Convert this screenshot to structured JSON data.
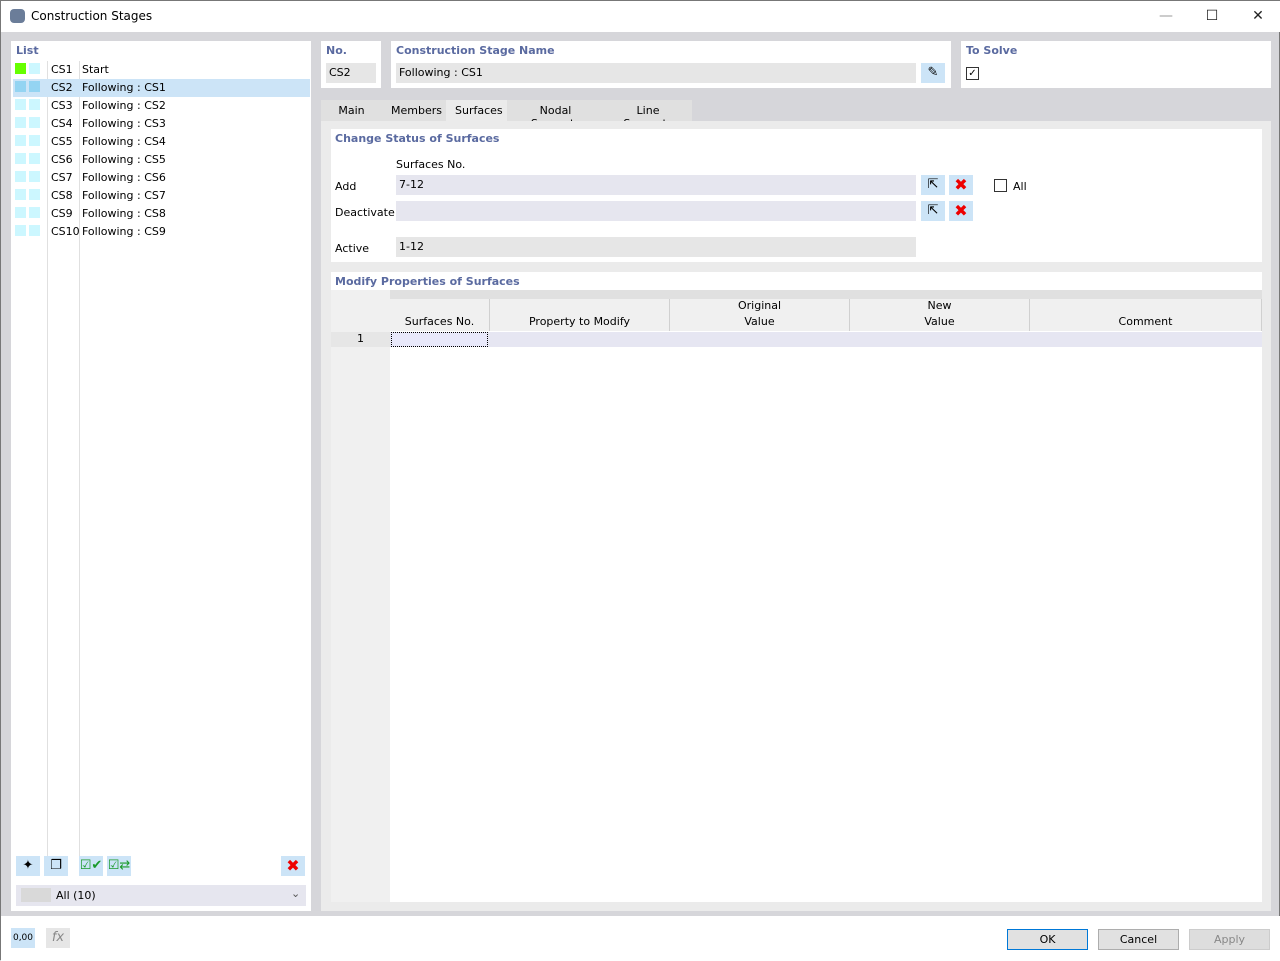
{
  "window": {
    "title": "Construction Stages",
    "minimize": "—",
    "maximize": "☐",
    "close": "✕"
  },
  "list": {
    "header": "List",
    "items": [
      {
        "id": "CS1",
        "name": "Start",
        "color1": "#66ff00",
        "color2": "#ccf7ff"
      },
      {
        "id": "CS2",
        "name": "Following : CS1",
        "color1": "#94d4f2",
        "color2": "#94d4f2",
        "selected": true
      },
      {
        "id": "CS3",
        "name": "Following : CS2",
        "color1": "#ccf7ff",
        "color2": "#ccf7ff"
      },
      {
        "id": "CS4",
        "name": "Following : CS3",
        "color1": "#ccf7ff",
        "color2": "#ccf7ff"
      },
      {
        "id": "CS5",
        "name": "Following : CS4",
        "color1": "#ccf7ff",
        "color2": "#ccf7ff"
      },
      {
        "id": "CS6",
        "name": "Following : CS5",
        "color1": "#ccf7ff",
        "color2": "#ccf7ff"
      },
      {
        "id": "CS7",
        "name": "Following : CS6",
        "color1": "#ccf7ff",
        "color2": "#ccf7ff"
      },
      {
        "id": "CS8",
        "name": "Following : CS7",
        "color1": "#ccf7ff",
        "color2": "#ccf7ff"
      },
      {
        "id": "CS9",
        "name": "Following : CS8",
        "color1": "#ccf7ff",
        "color2": "#ccf7ff"
      },
      {
        "id": "CS10",
        "name": "Following : CS9",
        "color1": "#ccf7ff",
        "color2": "#ccf7ff"
      }
    ],
    "filter": "All (10)"
  },
  "no": {
    "label": "No.",
    "value": "CS2"
  },
  "stage_name": {
    "label": "Construction Stage Name",
    "value": "Following : CS1"
  },
  "to_solve": {
    "label": "To Solve",
    "checked": true
  },
  "tabs": [
    "Main",
    "Members",
    "Surfaces",
    "Nodal Supports",
    "Line Supports"
  ],
  "active_tab": "Surfaces",
  "change_status": {
    "header": "Change Status of Surfaces",
    "col_label": "Surfaces No.",
    "add_label": "Add",
    "add_value": "7-12",
    "deactivate_label": "Deactivate",
    "deactivate_value": "",
    "active_label": "Active",
    "active_value": "1-12",
    "all_label": "All"
  },
  "modify": {
    "header": "Modify Properties of Surfaces",
    "columns": [
      "Surfaces No.",
      "Property to Modify",
      "Original\nValue",
      "New\nValue",
      "Comment"
    ],
    "rows": [
      "1"
    ]
  },
  "footer": {
    "ok": "OK",
    "cancel": "Cancel",
    "apply": "Apply",
    "units_icon": "0,00"
  }
}
